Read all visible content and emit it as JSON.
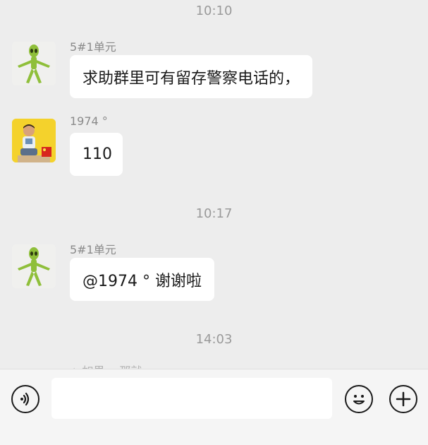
{
  "colors": {
    "background": "#ededed",
    "bubble": "#ffffff",
    "timestamp": "#9a9a9a",
    "sender": "#8a8a8a",
    "input_bar": "#f5f5f5"
  },
  "timestamps": [
    "10:10",
    "10:17",
    "14:03"
  ],
  "messages": [
    {
      "sender": "5#1单元",
      "avatar": "alien-avatar",
      "text": "求助群里可有留存警察电话的，"
    },
    {
      "sender": "1974 °",
      "avatar": "child-photo-avatar",
      "text": "110"
    },
    {
      "sender": "5#1单元",
      "avatar": "alien-avatar",
      "text": "@1974 ° 谢谢啦"
    }
  ],
  "partial_next": "△ 如果一 那就",
  "input_bar": {
    "voice_icon": "voice-icon",
    "input_value": "",
    "emoji_icon": "emoji-icon",
    "add_icon": "plus-icon"
  }
}
